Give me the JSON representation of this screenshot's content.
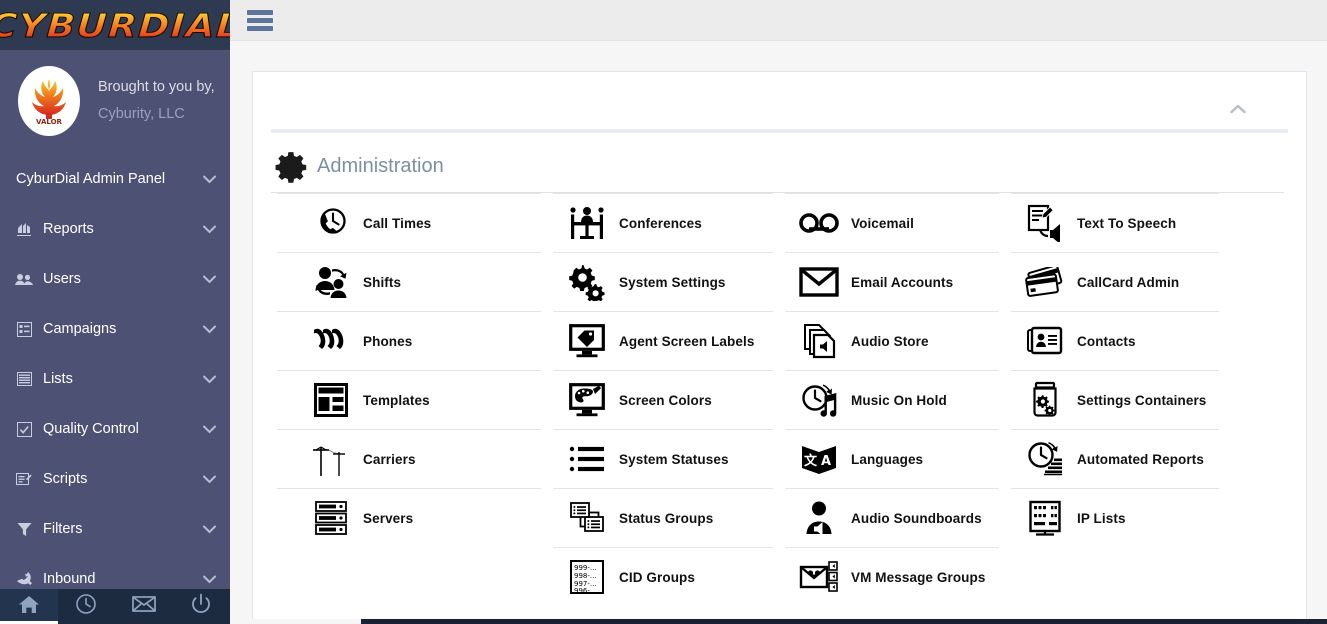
{
  "brand": {
    "logo_text": "CYBURDIAL",
    "tagline": "Brought to you by,",
    "company": "Cyburity, LLC",
    "avatar_icon": "phoenix-logo-icon"
  },
  "sidebar": {
    "header_item": {
      "label": "CyburDial Admin Panel",
      "icon": "none",
      "chevron": "chevron-down-icon"
    },
    "items": [
      {
        "label": "Reports",
        "icon": "report-chart-icon"
      },
      {
        "label": "Users",
        "icon": "users-icon"
      },
      {
        "label": "Campaigns",
        "icon": "campaigns-list-icon"
      },
      {
        "label": "Lists",
        "icon": "lists-icon"
      },
      {
        "label": "Quality Control",
        "icon": "checkbox-icon"
      },
      {
        "label": "Scripts",
        "icon": "script-edit-icon"
      },
      {
        "label": "Filters",
        "icon": "funnel-icon"
      },
      {
        "label": "Inbound",
        "icon": "inbound-call-icon"
      }
    ],
    "chevron": "chevron-down-icon",
    "footer": [
      {
        "icon": "home-icon",
        "name": "home",
        "active": true
      },
      {
        "icon": "clock-icon",
        "name": "clock",
        "active": false
      },
      {
        "icon": "envelope-icon",
        "name": "mail",
        "active": false
      },
      {
        "icon": "power-icon",
        "name": "power",
        "active": false
      }
    ]
  },
  "topbar": {
    "menu_icon": "hamburger-menu-icon"
  },
  "panel": {
    "collapse_icon": "chevron-up-icon",
    "section_icon": "gear-icon",
    "section_title": "Administration"
  },
  "colors": {
    "sidebar_bg": "#4d5275",
    "logo_bar_bg": "#2d3a52",
    "sidebar_footer_bg": "#1d2b41",
    "topbar_bg": "#ececec",
    "hamburger": "#5c7499",
    "section_title": "#7d8fa6",
    "panel_rule": "#e7edf2",
    "page_bg": "#f6f6f6"
  },
  "admin_columns": [
    {
      "column": 1,
      "tiles": [
        {
          "label": "Call Times",
          "icon": "phone-clock-icon"
        },
        {
          "label": "Shifts",
          "icon": "shift-users-icon"
        },
        {
          "label": "Phones",
          "icon": "phones-icon"
        },
        {
          "label": "Templates",
          "icon": "template-layout-icon"
        },
        {
          "label": "Carriers",
          "icon": "telephone-pole-icon"
        },
        {
          "label": "Servers",
          "icon": "server-rack-icon"
        }
      ]
    },
    {
      "column": 2,
      "tiles": [
        {
          "label": "Conferences",
          "icon": "conference-table-icon"
        },
        {
          "label": "System Settings",
          "icon": "gears-icon"
        },
        {
          "label": "Agent Screen Labels",
          "icon": "monitor-tag-icon"
        },
        {
          "label": "Screen Colors",
          "icon": "monitor-palette-icon"
        },
        {
          "label": "System Statuses",
          "icon": "bullet-list-icon"
        },
        {
          "label": "Status Groups",
          "icon": "stacked-lists-icon"
        },
        {
          "label": "CID Groups",
          "icon": "cid-number-list-icon",
          "icon_lines": [
            "999-...",
            "998-...",
            "997-...",
            "996-..."
          ]
        }
      ]
    },
    {
      "column": 3,
      "tiles": [
        {
          "label": "Voicemail",
          "icon": "voicemail-tape-icon"
        },
        {
          "label": "Email Accounts",
          "icon": "envelope-icon"
        },
        {
          "label": "Audio Store",
          "icon": "audio-files-stack-icon"
        },
        {
          "label": "Music On Hold",
          "icon": "clock-music-note-icon"
        },
        {
          "label": "Languages",
          "icon": "language-translate-icon"
        },
        {
          "label": "Audio Soundboards",
          "icon": "person-speaker-icon"
        },
        {
          "label": "VM Message Groups",
          "icon": "envelope-speakers-icon"
        }
      ]
    },
    {
      "column": 4,
      "tiles": [
        {
          "label": "Text To Speech",
          "icon": "note-speaker-icon"
        },
        {
          "label": "CallCard Admin",
          "icon": "credit-cards-icon"
        },
        {
          "label": "Contacts",
          "icon": "contact-cards-icon"
        },
        {
          "label": "Settings Containers",
          "icon": "jar-gears-icon"
        },
        {
          "label": "Automated Reports",
          "icon": "clock-chart-icon"
        },
        {
          "label": "IP Lists",
          "icon": "server-ip-icon"
        }
      ]
    }
  ]
}
